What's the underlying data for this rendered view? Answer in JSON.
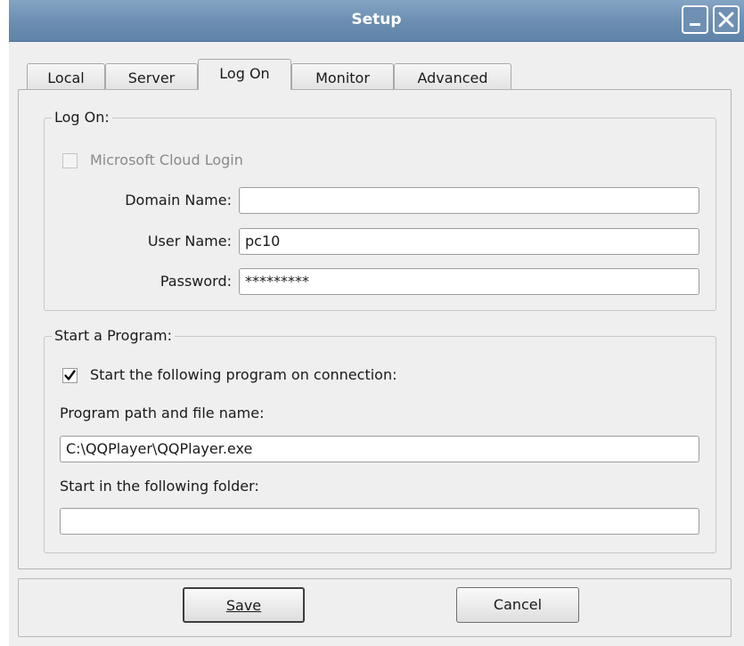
{
  "window": {
    "title": "Setup"
  },
  "tabs": [
    {
      "label": "Local",
      "active": false
    },
    {
      "label": "Server",
      "active": false
    },
    {
      "label": "Log On",
      "active": true
    },
    {
      "label": "Monitor",
      "active": false
    },
    {
      "label": "Advanced",
      "active": false
    }
  ],
  "logon": {
    "group_label": "Log On:",
    "cloud_login": {
      "label": "Microsoft Cloud Login",
      "checked": false,
      "enabled": false
    },
    "domain": {
      "label": "Domain Name:",
      "value": ""
    },
    "user": {
      "label": "User Name:",
      "value": "pc10"
    },
    "password": {
      "label": "Password:",
      "value": "*********"
    }
  },
  "program": {
    "group_label": "Start a Program:",
    "start_on_connect": {
      "label": "Start the following program on connection:",
      "checked": true
    },
    "path_label": "Program path and file name:",
    "path_value": "C:\\QQPlayer\\QQPlayer.exe",
    "folder_label": "Start in the following folder:",
    "folder_value": ""
  },
  "buttons": {
    "save": "Save",
    "cancel": "Cancel"
  },
  "icons": {
    "minimize": "minimize-icon",
    "close": "close-icon",
    "check": "checkmark-icon"
  }
}
